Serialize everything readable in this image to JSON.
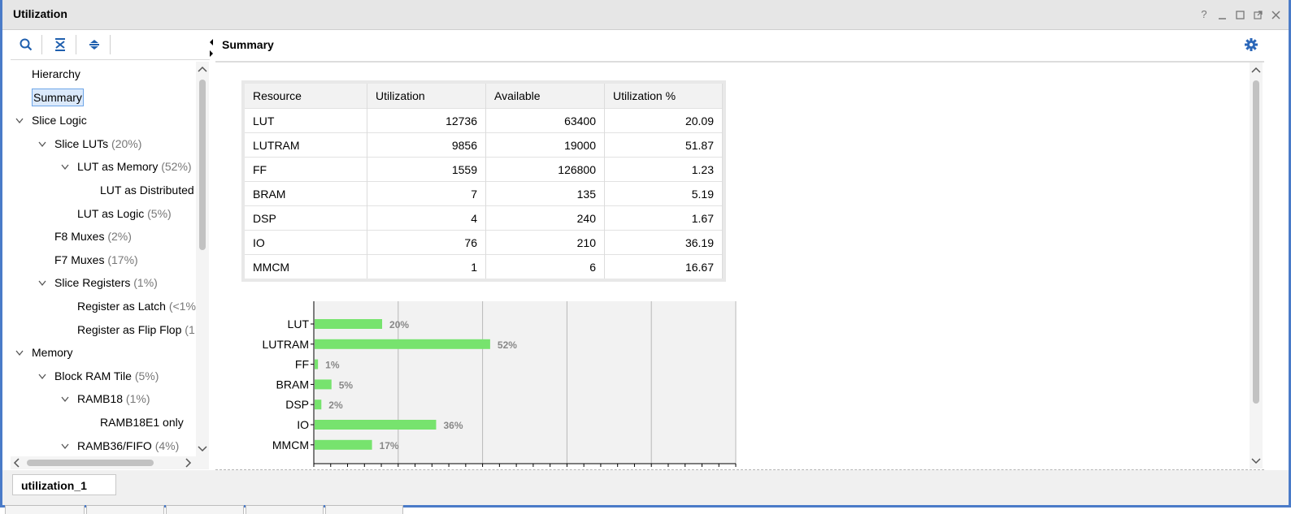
{
  "window": {
    "title": "Utilization"
  },
  "summary_header": {
    "label": "Summary"
  },
  "tree": {
    "items": [
      {
        "label": "Hierarchy",
        "pct": "",
        "level": 0,
        "chev": ""
      },
      {
        "label": "Summary",
        "pct": "",
        "level": 0,
        "chev": "",
        "selected": true
      },
      {
        "label": "Slice Logic",
        "pct": "",
        "level": 0,
        "chev": "v"
      },
      {
        "label": "Slice LUTs",
        "pct": "(20%)",
        "level": 1,
        "chev": "v"
      },
      {
        "label": "LUT as Memory",
        "pct": "(52%)",
        "level": 2,
        "chev": "v"
      },
      {
        "label": "LUT as Distributed",
        "pct": "",
        "level": 3,
        "chev": ""
      },
      {
        "label": "LUT as Logic",
        "pct": "(5%)",
        "level": 2,
        "chev": ""
      },
      {
        "label": "F8 Muxes",
        "pct": "(2%)",
        "level": 1,
        "chev": ""
      },
      {
        "label": "F7 Muxes",
        "pct": "(17%)",
        "level": 1,
        "chev": ""
      },
      {
        "label": "Slice Registers",
        "pct": "(1%)",
        "level": 1,
        "chev": "v"
      },
      {
        "label": "Register as Latch",
        "pct": "(<1%",
        "level": 2,
        "chev": ""
      },
      {
        "label": "Register as Flip Flop",
        "pct": "(1",
        "level": 2,
        "chev": ""
      },
      {
        "label": "Memory",
        "pct": "",
        "level": 0,
        "chev": "v"
      },
      {
        "label": "Block RAM Tile",
        "pct": "(5%)",
        "level": 1,
        "chev": "v"
      },
      {
        "label": "RAMB18",
        "pct": "(1%)",
        "level": 2,
        "chev": "v"
      },
      {
        "label": "RAMB18E1 only",
        "pct": "",
        "level": 3,
        "chev": ""
      },
      {
        "label": "RAMB36/FIFO",
        "pct": "(4%)",
        "level": 2,
        "chev": "v"
      }
    ]
  },
  "table": {
    "headers": [
      "Resource",
      "Utilization",
      "Available",
      "Utilization %"
    ],
    "rows": [
      [
        "LUT",
        "12736",
        "63400",
        "20.09"
      ],
      [
        "LUTRAM",
        "9856",
        "19000",
        "51.87"
      ],
      [
        "FF",
        "1559",
        "126800",
        "1.23"
      ],
      [
        "BRAM",
        "7",
        "135",
        "5.19"
      ],
      [
        "DSP",
        "4",
        "240",
        "1.67"
      ],
      [
        "IO",
        "76",
        "210",
        "36.19"
      ],
      [
        "MMCM",
        "1",
        "6",
        "16.67"
      ]
    ]
  },
  "chart_data": {
    "type": "bar",
    "orientation": "horizontal",
    "categories": [
      "LUT",
      "LUTRAM",
      "FF",
      "BRAM",
      "DSP",
      "IO",
      "MMCM"
    ],
    "values": [
      20,
      52,
      1,
      5,
      2,
      36,
      17
    ],
    "data_labels": [
      "20%",
      "52%",
      "1%",
      "5%",
      "2%",
      "36%",
      "17%"
    ],
    "xlim": [
      0,
      125
    ],
    "grid": true,
    "bar_color": "#77e36e"
  },
  "bottom_tab": {
    "label": "utilization_1"
  },
  "colors": {
    "accent": "#4a7bc8",
    "selection": "#dbe9fb",
    "gear": "#2a66b8"
  }
}
